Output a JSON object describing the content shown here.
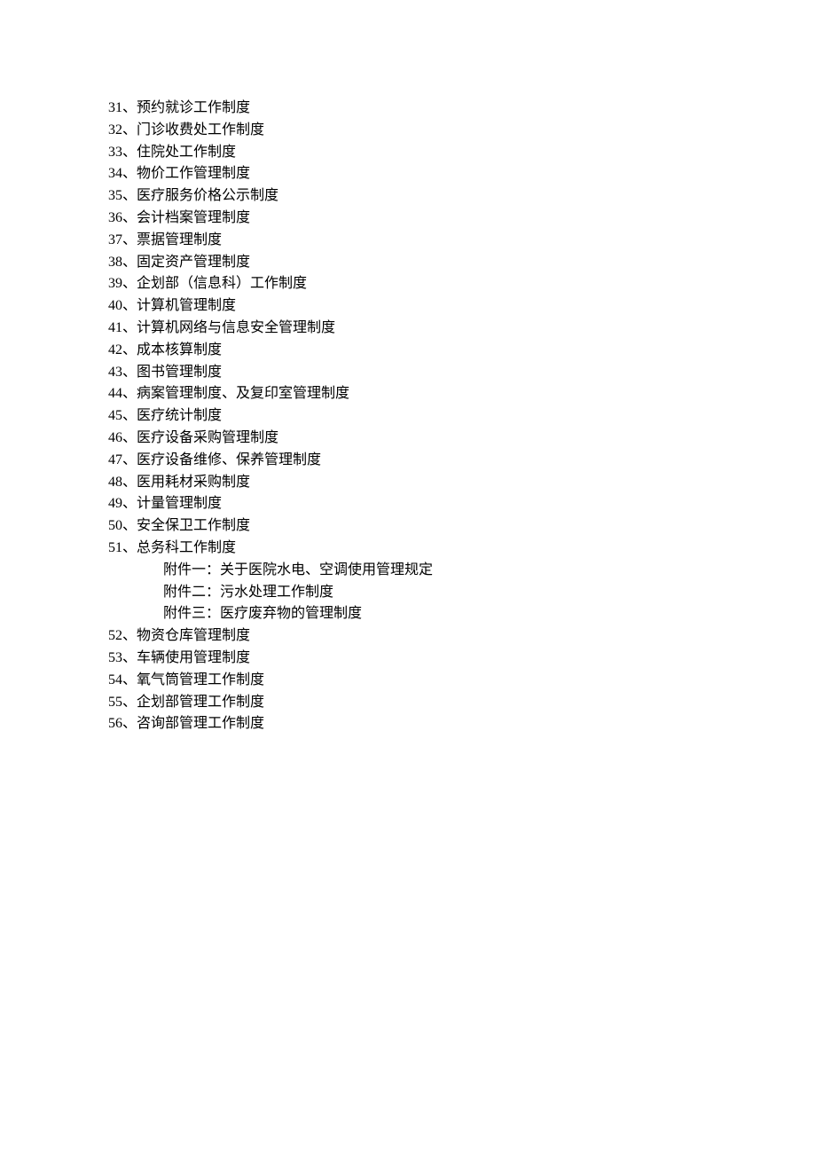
{
  "items": [
    {
      "num": "31",
      "text": "预约就诊工作制度"
    },
    {
      "num": "32",
      "text": "门诊收费处工作制度"
    },
    {
      "num": "33",
      "text": "住院处工作制度"
    },
    {
      "num": "34",
      "text": "物价工作管理制度"
    },
    {
      "num": "35",
      "text": "医疗服务价格公示制度"
    },
    {
      "num": "36",
      "text": "会计档案管理制度"
    },
    {
      "num": "37",
      "text": "票据管理制度"
    },
    {
      "num": "38",
      "text": "固定资产管理制度"
    },
    {
      "num": "39",
      "text": "企划部（信息科）工作制度"
    },
    {
      "num": "40",
      "text": "计算机管理制度"
    },
    {
      "num": "41",
      "text": "计算机网络与信息安全管理制度"
    },
    {
      "num": "42",
      "text": "成本核算制度"
    },
    {
      "num": "43",
      "text": "图书管理制度"
    },
    {
      "num": "44",
      "text": "病案管理制度、及复印室管理制度"
    },
    {
      "num": "45",
      "text": "医疗统计制度"
    },
    {
      "num": "46",
      "text": "医疗设备采购管理制度"
    },
    {
      "num": "47",
      "text": "医疗设备维修、保养管理制度"
    },
    {
      "num": "48",
      "text": "医用耗材采购制度"
    },
    {
      "num": "49",
      "text": "计量管理制度"
    },
    {
      "num": "50",
      "text": "安全保卫工作制度"
    },
    {
      "num": "51",
      "text": "总务科工作制度",
      "attachments": [
        "附件一：关于医院水电、空调使用管理规定",
        "附件二：污水处理工作制度",
        "附件三：医疗废弃物的管理制度"
      ]
    },
    {
      "num": "52",
      "text": "物资仓库管理制度"
    },
    {
      "num": "53",
      "text": "车辆使用管理制度"
    },
    {
      "num": "54",
      "text": "氧气筒管理工作制度"
    },
    {
      "num": "55",
      "text": "企划部管理工作制度"
    },
    {
      "num": "56",
      "text": "咨询部管理工作制度"
    }
  ]
}
